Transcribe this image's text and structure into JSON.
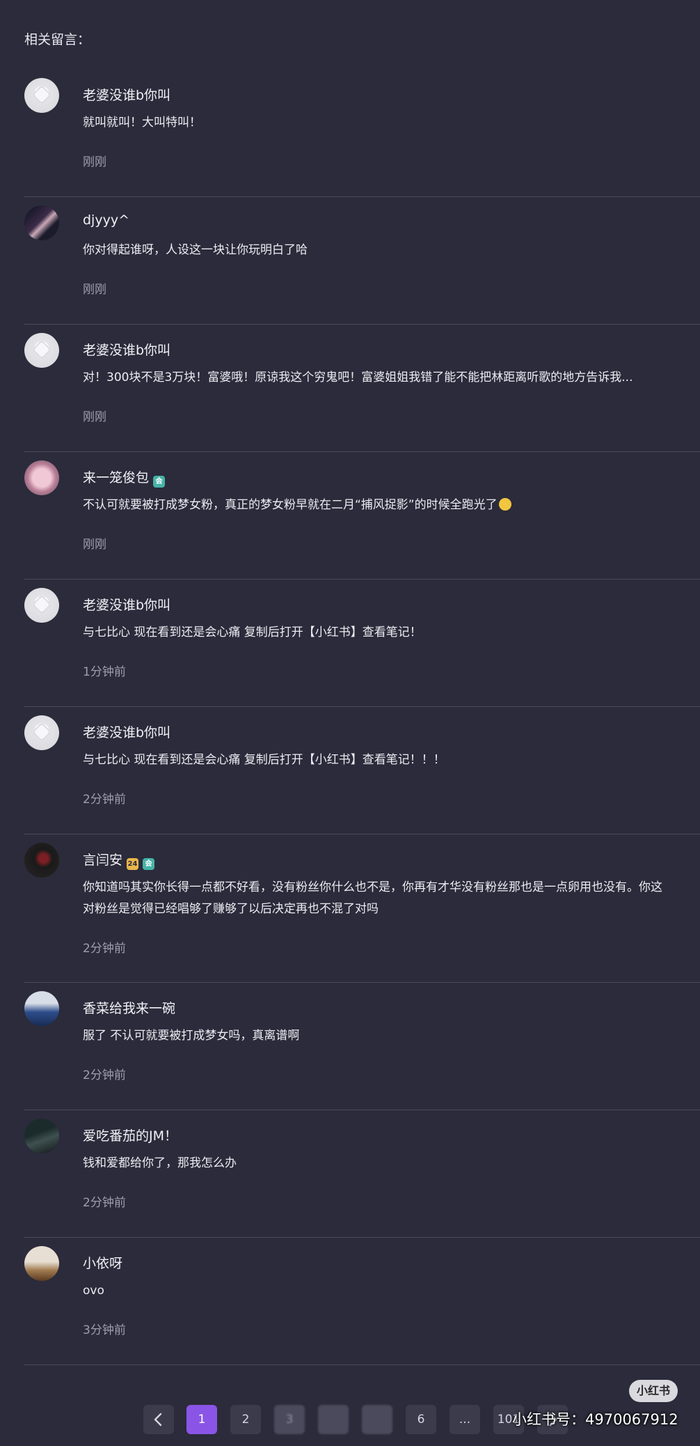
{
  "header": {
    "title": "相关留言："
  },
  "comments": [
    {
      "name": "老婆没谁b你叫",
      "text": "就叫就叫！大叫特叫！",
      "time": "刚刚",
      "avatar": "default-avatar"
    },
    {
      "name": "djyyy^",
      "text": "你对得起谁呀，人设这一块让你玩明白了哈",
      "time": "刚刚",
      "avatar": "girl-photo-avatar"
    },
    {
      "name": "老婆没谁b你叫",
      "text": "对！300块不是3万块！富婆哦！原谅我这个穷鬼吧！富婆姐姐我错了能不能把林距离听歌的地方告诉我...",
      "time": "刚刚",
      "avatar": "default-avatar"
    },
    {
      "name": "来一笼俊包",
      "badge": "会",
      "text": "不认可就要被打成梦女粉，真正的梦女粉早就在二月“捕风捉影”的时候全跑光了",
      "time": "刚刚",
      "avatar": "pink-bear-avatar",
      "emoji": "smile-emoji"
    },
    {
      "name": "老婆没谁b你叫",
      "text": "与七比心 现在看到还是会心痛 复制后打开【小红书】查看笔记！",
      "time": "1分钟前",
      "avatar": "default-avatar"
    },
    {
      "name": "老婆没谁b你叫",
      "text": "与七比心 现在看到还是会心痛 复制后打开【小红书】查看笔记！！！",
      "time": "2分钟前",
      "avatar": "default-avatar"
    },
    {
      "name": "言闫安",
      "badge_gold": "24",
      "badge": "会",
      "text": "你知道吗其实你长得一点都不好看，没有粉丝你什么也不是，你再有才华没有粉丝那也是一点卵用也没有。你这",
      "text2": "对粉丝是觉得已经唱够了赚够了以后决定再也不混了对吗",
      "time": "2分钟前",
      "avatar": "dark-photo-avatar"
    },
    {
      "name": "香菜给我来一碗",
      "text": "服了 不认可就要被打成梦女吗，真离谱啊",
      "time": "2分钟前",
      "avatar": "blue-photo-avatar"
    },
    {
      "name": "爱吃番茄的JM！",
      "text": "钱和爱都给你了，那我怎么办",
      "time": "2分钟前",
      "avatar": "dim-photo-avatar"
    },
    {
      "name": "小依呀",
      "text": "ovo",
      "time": "3分钟前",
      "avatar": "tan-photo-avatar"
    }
  ],
  "pagination": {
    "prev_icon": "chevron-left-icon",
    "pages": [
      "1",
      "2",
      "3",
      "",
      "",
      "6",
      "...",
      "101"
    ],
    "current": "1",
    "next_icon": "chevron-right-icon"
  },
  "watermark": {
    "logo": "小红书",
    "id_text": "小红书号：4970067912"
  }
}
